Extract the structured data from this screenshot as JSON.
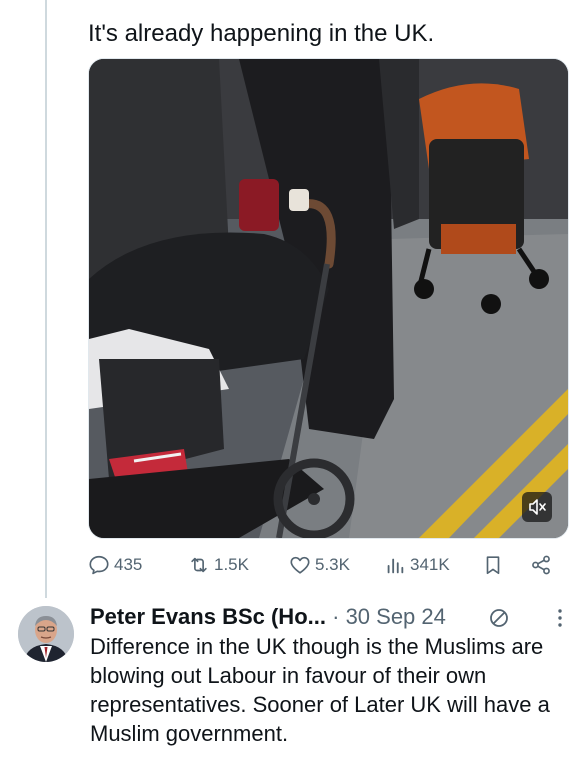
{
  "tweet": {
    "text": "It's already happening in the UK.",
    "media": {
      "kind": "video",
      "muted": true,
      "control_icon": "volume-muted-icon"
    },
    "actions": {
      "replies": "435",
      "reposts": "1.5K",
      "likes": "5.3K",
      "views": "341K"
    }
  },
  "reply": {
    "author_name": "Peter Evans BSc (Ho...",
    "separator": "·",
    "date": "30 Sep 24",
    "badge_icon": "no-entry-icon",
    "text": "Difference in the UK though is the Muslims are blowing out Labour in favour of their own representatives. Sooner of Later UK will have a Muslim government."
  },
  "colors": {
    "text": "#0f1419",
    "secondary": "#536471",
    "border": "#cfd9de",
    "road_line": "#d9b128",
    "stroller_hood": "#c2561f"
  }
}
